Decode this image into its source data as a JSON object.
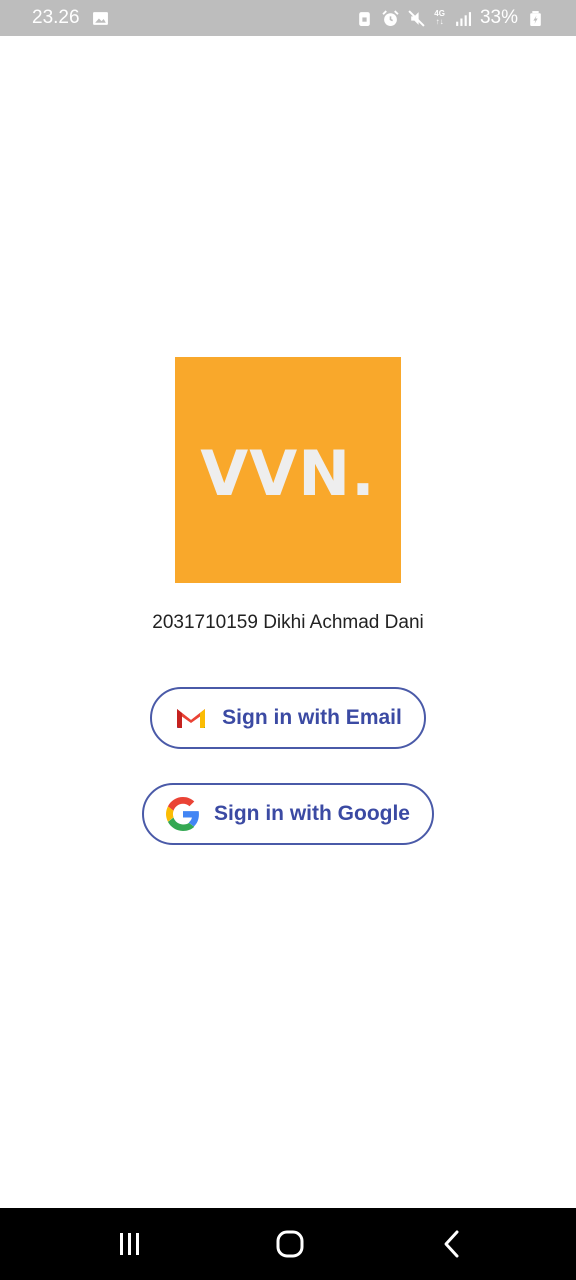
{
  "status_bar": {
    "time": "23.26",
    "network_label": "4G",
    "battery": "33%",
    "icons": [
      "gallery-icon",
      "lock-icon",
      "alarm-icon",
      "mute-icon",
      "network-4g-icon",
      "signal-icon",
      "battery-icon"
    ]
  },
  "logo": {
    "text": "VVN.",
    "background_color": "#f9a82b",
    "text_color": "#eeeeee"
  },
  "student": {
    "info": "2031710159 Dikhi Achmad Dani"
  },
  "buttons": {
    "email_label": "Sign in with Email",
    "google_label": "Sign in with Google",
    "accent_color": "#3b4aa3"
  },
  "nav": {
    "icons": [
      "recents-icon",
      "home-icon",
      "back-icon"
    ]
  }
}
